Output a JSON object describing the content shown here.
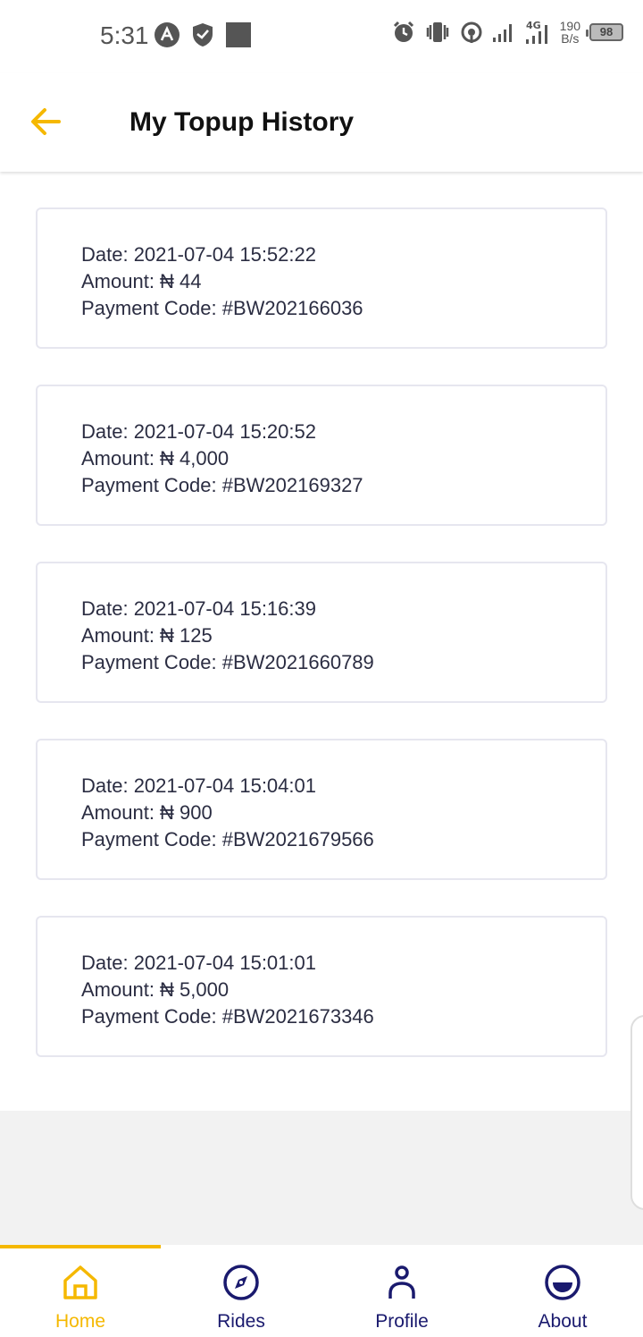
{
  "status_bar": {
    "time": "5:31",
    "net_speed_value": "190",
    "net_speed_unit": "B/s",
    "network_type": "4G",
    "battery": "98"
  },
  "header": {
    "title": "My Topup History"
  },
  "colors": {
    "accent": "#f5b800",
    "nav_inactive": "#1a1a6e",
    "text": "#2b2d42",
    "card_border": "#e6e6ef"
  },
  "topups": [
    {
      "date": "Date: 2021-07-04 15:52:22",
      "amount": "Amount: ₦ 44",
      "code": "Payment Code: #BW202166036"
    },
    {
      "date": "Date: 2021-07-04 15:20:52",
      "amount": "Amount: ₦ 4,000",
      "code": "Payment Code: #BW202169327"
    },
    {
      "date": "Date: 2021-07-04 15:16:39",
      "amount": "Amount: ₦ 125",
      "code": "Payment Code: #BW2021660789"
    },
    {
      "date": "Date: 2021-07-04 15:04:01",
      "amount": "Amount: ₦ 900",
      "code": "Payment Code: #BW2021679566"
    },
    {
      "date": "Date: 2021-07-04 15:01:01",
      "amount": "Amount: ₦ 5,000",
      "code": "Payment Code: #BW2021673346"
    }
  ],
  "bottom_nav": {
    "items": [
      {
        "label": "Home",
        "icon": "home-icon",
        "active": true
      },
      {
        "label": "Rides",
        "icon": "compass-icon",
        "active": false
      },
      {
        "label": "Profile",
        "icon": "person-icon",
        "active": false
      },
      {
        "label": "About",
        "icon": "smiley-icon",
        "active": false
      }
    ]
  }
}
